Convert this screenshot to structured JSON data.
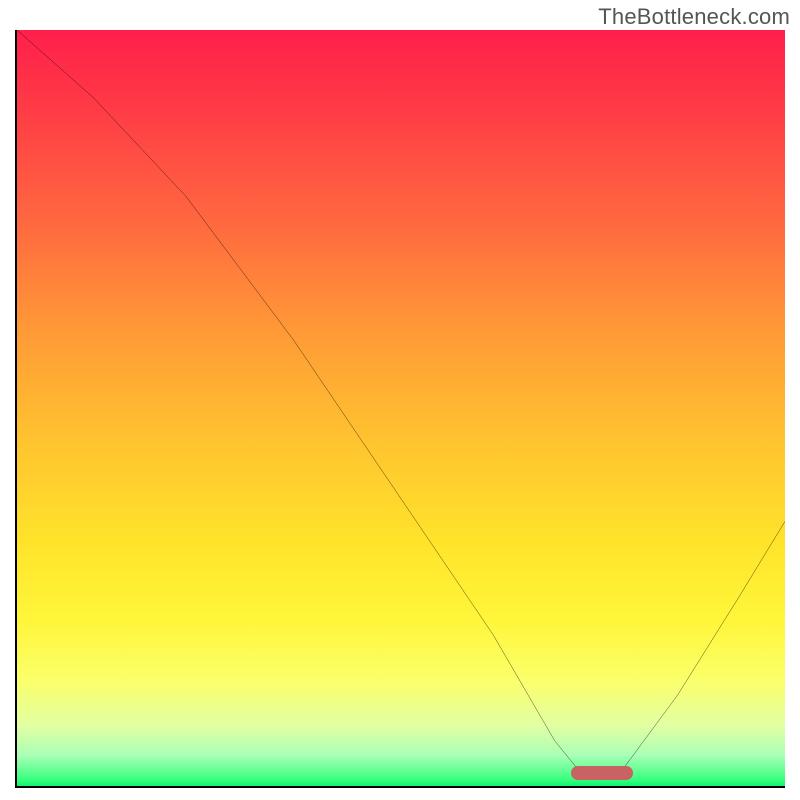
{
  "watermark": "TheBottleneck.com",
  "chart_data": {
    "type": "line",
    "title": "",
    "xlabel": "",
    "ylabel": "",
    "xlim": [
      0,
      100
    ],
    "ylim": [
      0,
      100
    ],
    "grid": false,
    "legend": false,
    "annotations": [],
    "series": [
      {
        "name": "bottleneck-curve",
        "x": [
          0,
          10,
          22,
          36,
          50,
          62,
          70,
          74,
          78,
          86,
          94,
          100
        ],
        "y": [
          100,
          91,
          78,
          59,
          38,
          20,
          6,
          1,
          1,
          12,
          25,
          35
        ]
      }
    ],
    "marker": {
      "name": "optimal-range",
      "x_start": 72,
      "x_end": 80,
      "y": 0.8,
      "color": "#c96262"
    },
    "background_gradient": {
      "stops": [
        {
          "pos": 0,
          "color": "#ff1f4b"
        },
        {
          "pos": 25,
          "color": "#ff6740"
        },
        {
          "pos": 55,
          "color": "#ffc52f"
        },
        {
          "pos": 78,
          "color": "#fff63a"
        },
        {
          "pos": 96,
          "color": "#a8ffb6"
        },
        {
          "pos": 100,
          "color": "#10f56e"
        }
      ]
    }
  }
}
